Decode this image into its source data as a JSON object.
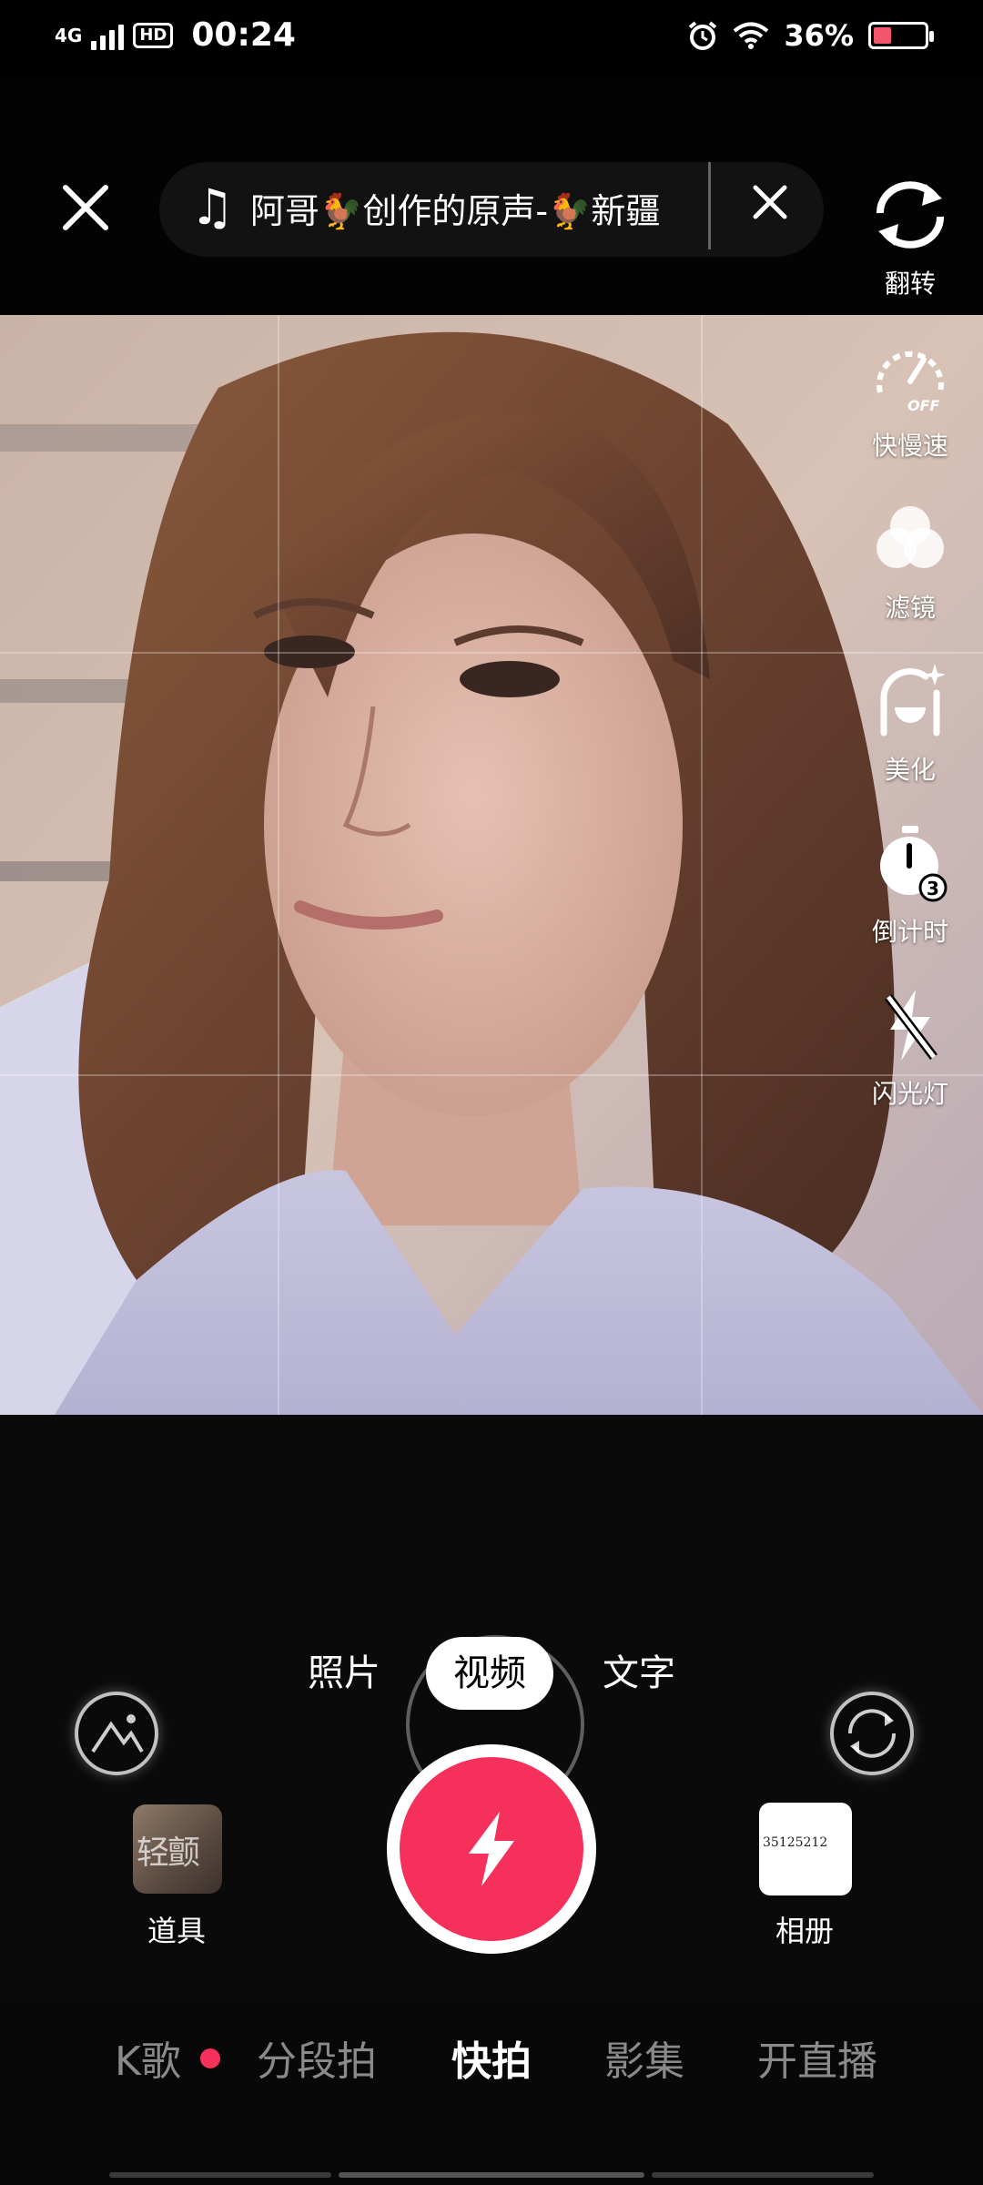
{
  "status_bar": {
    "network": "4G",
    "hd": "HD",
    "time": "00:24",
    "battery_text": "36%",
    "battery_level": 0.36
  },
  "top_bar": {
    "music_title": "阿哥🐓创作的原声-🐓新疆"
  },
  "tools": [
    {
      "label": "翻转",
      "icon": "flip-camera-icon"
    },
    {
      "label": "快慢速",
      "icon": "speed-off-icon",
      "badge": "OFF"
    },
    {
      "label": "滤镜",
      "icon": "filter-icon"
    },
    {
      "label": "美化",
      "icon": "beautify-icon"
    },
    {
      "label": "倒计时",
      "icon": "timer-icon",
      "badge": "3"
    },
    {
      "label": "闪光灯",
      "icon": "flash-off-icon"
    }
  ],
  "modes": {
    "photo": "照片",
    "video": "视频",
    "text": "文字",
    "active": "视频"
  },
  "props": {
    "label": "道具",
    "thumb_text": "轻颤"
  },
  "album": {
    "label": "相册",
    "thumb_text": "35125212"
  },
  "tabs": [
    {
      "label": "K歌",
      "active": false,
      "dot": true
    },
    {
      "label": "分段拍",
      "active": false
    },
    {
      "label": "快拍",
      "active": true
    },
    {
      "label": "影集",
      "active": false
    },
    {
      "label": "开直播",
      "active": false
    }
  ],
  "colors": {
    "accent": "#f5305a"
  }
}
